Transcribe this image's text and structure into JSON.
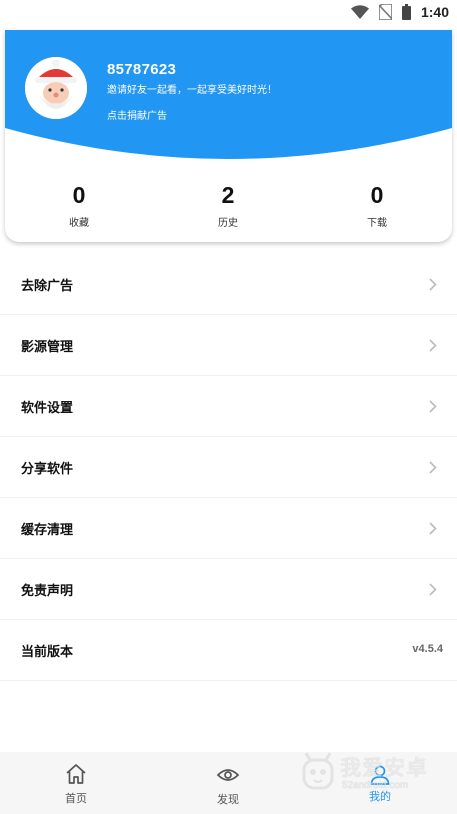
{
  "status_bar": {
    "time": "1:40",
    "icons": [
      "wifi-icon",
      "no-sim-icon",
      "battery-icon"
    ]
  },
  "profile": {
    "user_id": "85787623",
    "slogan": "邀请好友一起看，一起享受美好时光！",
    "donate_label": "点击捐献广告",
    "header_color": "#2196f3"
  },
  "stats": [
    {
      "value": "0",
      "label": "收藏"
    },
    {
      "value": "2",
      "label": "历史"
    },
    {
      "value": "0",
      "label": "下载"
    }
  ],
  "menu": [
    {
      "label": "去除广告"
    },
    {
      "label": "影源管理"
    },
    {
      "label": "软件设置"
    },
    {
      "label": "分享软件"
    },
    {
      "label": "缓存清理"
    },
    {
      "label": "免责声明"
    },
    {
      "label": "当前版本",
      "value": "v4.5.4"
    }
  ],
  "tabbar": [
    {
      "label": "首页",
      "icon": "home-icon",
      "active": false
    },
    {
      "label": "发现",
      "icon": "eye-icon",
      "active": false
    },
    {
      "label": "我的",
      "icon": "user-icon",
      "active": true
    }
  ],
  "watermark": {
    "text": "我爱安卓",
    "sub": "52android.com"
  },
  "colors": {
    "accent": "#2196f3",
    "chevron": "#bbbbbb",
    "tabbar_bg": "#f6f6f6"
  }
}
